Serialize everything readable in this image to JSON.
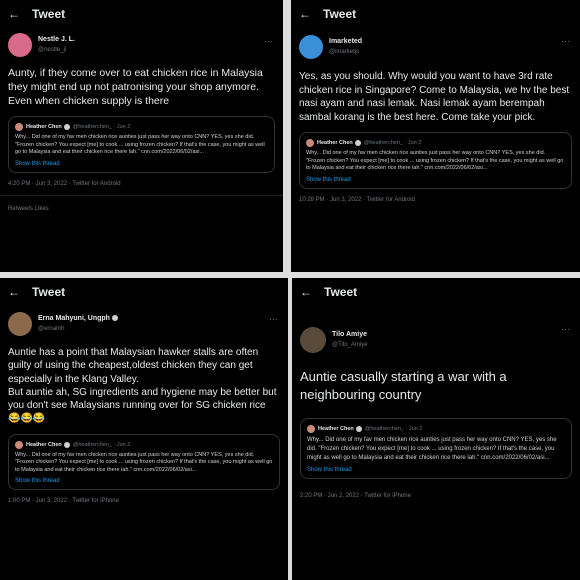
{
  "header_title": "Tweet",
  "quote": {
    "name": "Heather Chen",
    "handle_time": "@heatherchen_ · Jun 2",
    "text": "Why... Did one of my fav men chicken rice aunties just pass her way onto CNN? YES, yes she did. \"Frozen chicken? You expect [me] to cook ... using frozen chicken? If that's the case, you might as well go to Malaysia and eat their chicken rice there lah.\" cnn.com/2022/06/02/asi...",
    "show_thread": "Show this thread"
  },
  "tweets": [
    {
      "name": "Nestle J. L.",
      "handle": "@nestle_jl",
      "text": "Aunty, if they come over to eat chicken rice in Malaysia they might end up not patronising your shop anymore. Even when chicken supply is there",
      "meta": "4:20 PM · Jun 3, 2022 · Twitter for Android",
      "stats": "Retweets    Likes",
      "avatar_color": "#d96a8b"
    },
    {
      "name": "Imarketed",
      "handle": "@imarketjs",
      "text": "Yes, as you should. Why would you want to have 3rd rate chicken rice in Singapore? Come to Malaysia, we hv the best nasi ayam and nasi lemak. Nasi lemak ayam berempah sambal korang is the best here. Come take your pick.",
      "meta": "10:28 PM · Jun 3, 2022 · Twitter for Android",
      "avatar_color": "#3a8fd8"
    },
    {
      "name": "Erna Mahyuni, Ungph",
      "handle": "@ernamh",
      "text": "Auntie has a point that Malaysian hawker stalls are often guilty of using the cheapest,oldest chicken they can get especially in the Klang Valley.\nBut auntie ah, SG ingredients and hygiene may be better but you don't see Malaysians running over for SG chicken rice 😂😂😂",
      "meta": "1:00 PM · Jun 3, 2022 · Twitter for iPhone",
      "avatar_color": "#8a6a4a"
    },
    {
      "name": "Tilo Amiye",
      "handle": "@Tilo_Amiye",
      "text": "Auntie casually starting a war with a neighbouring country",
      "meta": "2:20 PM · Jun 2, 2022 · Twitter for iPhone",
      "avatar_color": "#5a4a3a"
    }
  ]
}
